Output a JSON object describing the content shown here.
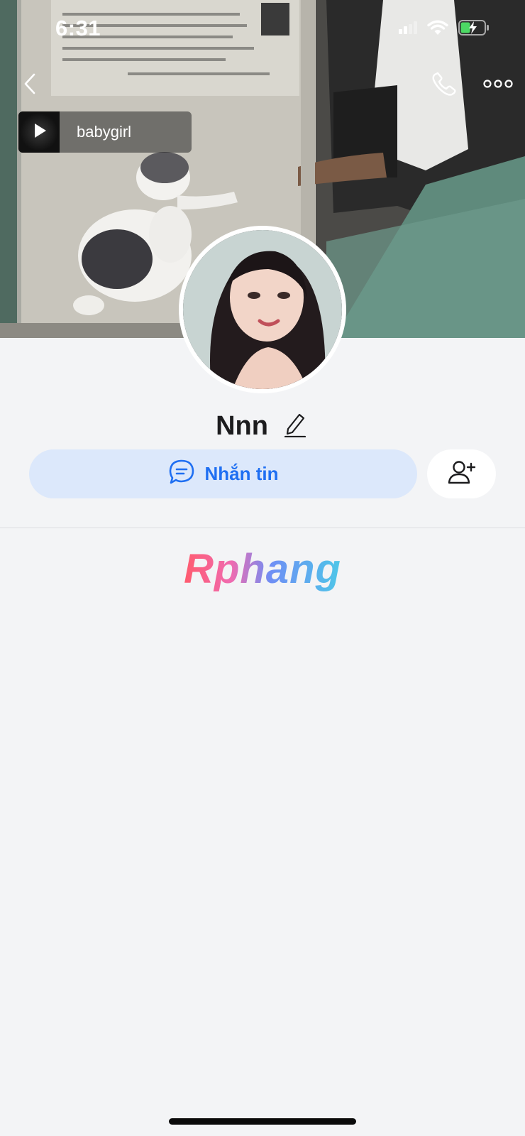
{
  "status_bar": {
    "time": "6:31"
  },
  "icons": {
    "back": "chevron-left-icon",
    "call": "phone-icon",
    "more": "more-horizontal-icon",
    "play": "play-icon",
    "edit": "pencil-icon",
    "message": "chat-bubble-icon",
    "add_friend": "user-plus-icon"
  },
  "music": {
    "title": "babygirl"
  },
  "profile": {
    "name": "Nnn"
  },
  "actions": {
    "message_label": "Nhắn tin"
  },
  "watermark": {
    "text": "Rphang"
  },
  "colors": {
    "accent_blue": "#1f6ff2",
    "message_button_bg": "#dce8fb",
    "page_bg": "#f3f4f6"
  }
}
